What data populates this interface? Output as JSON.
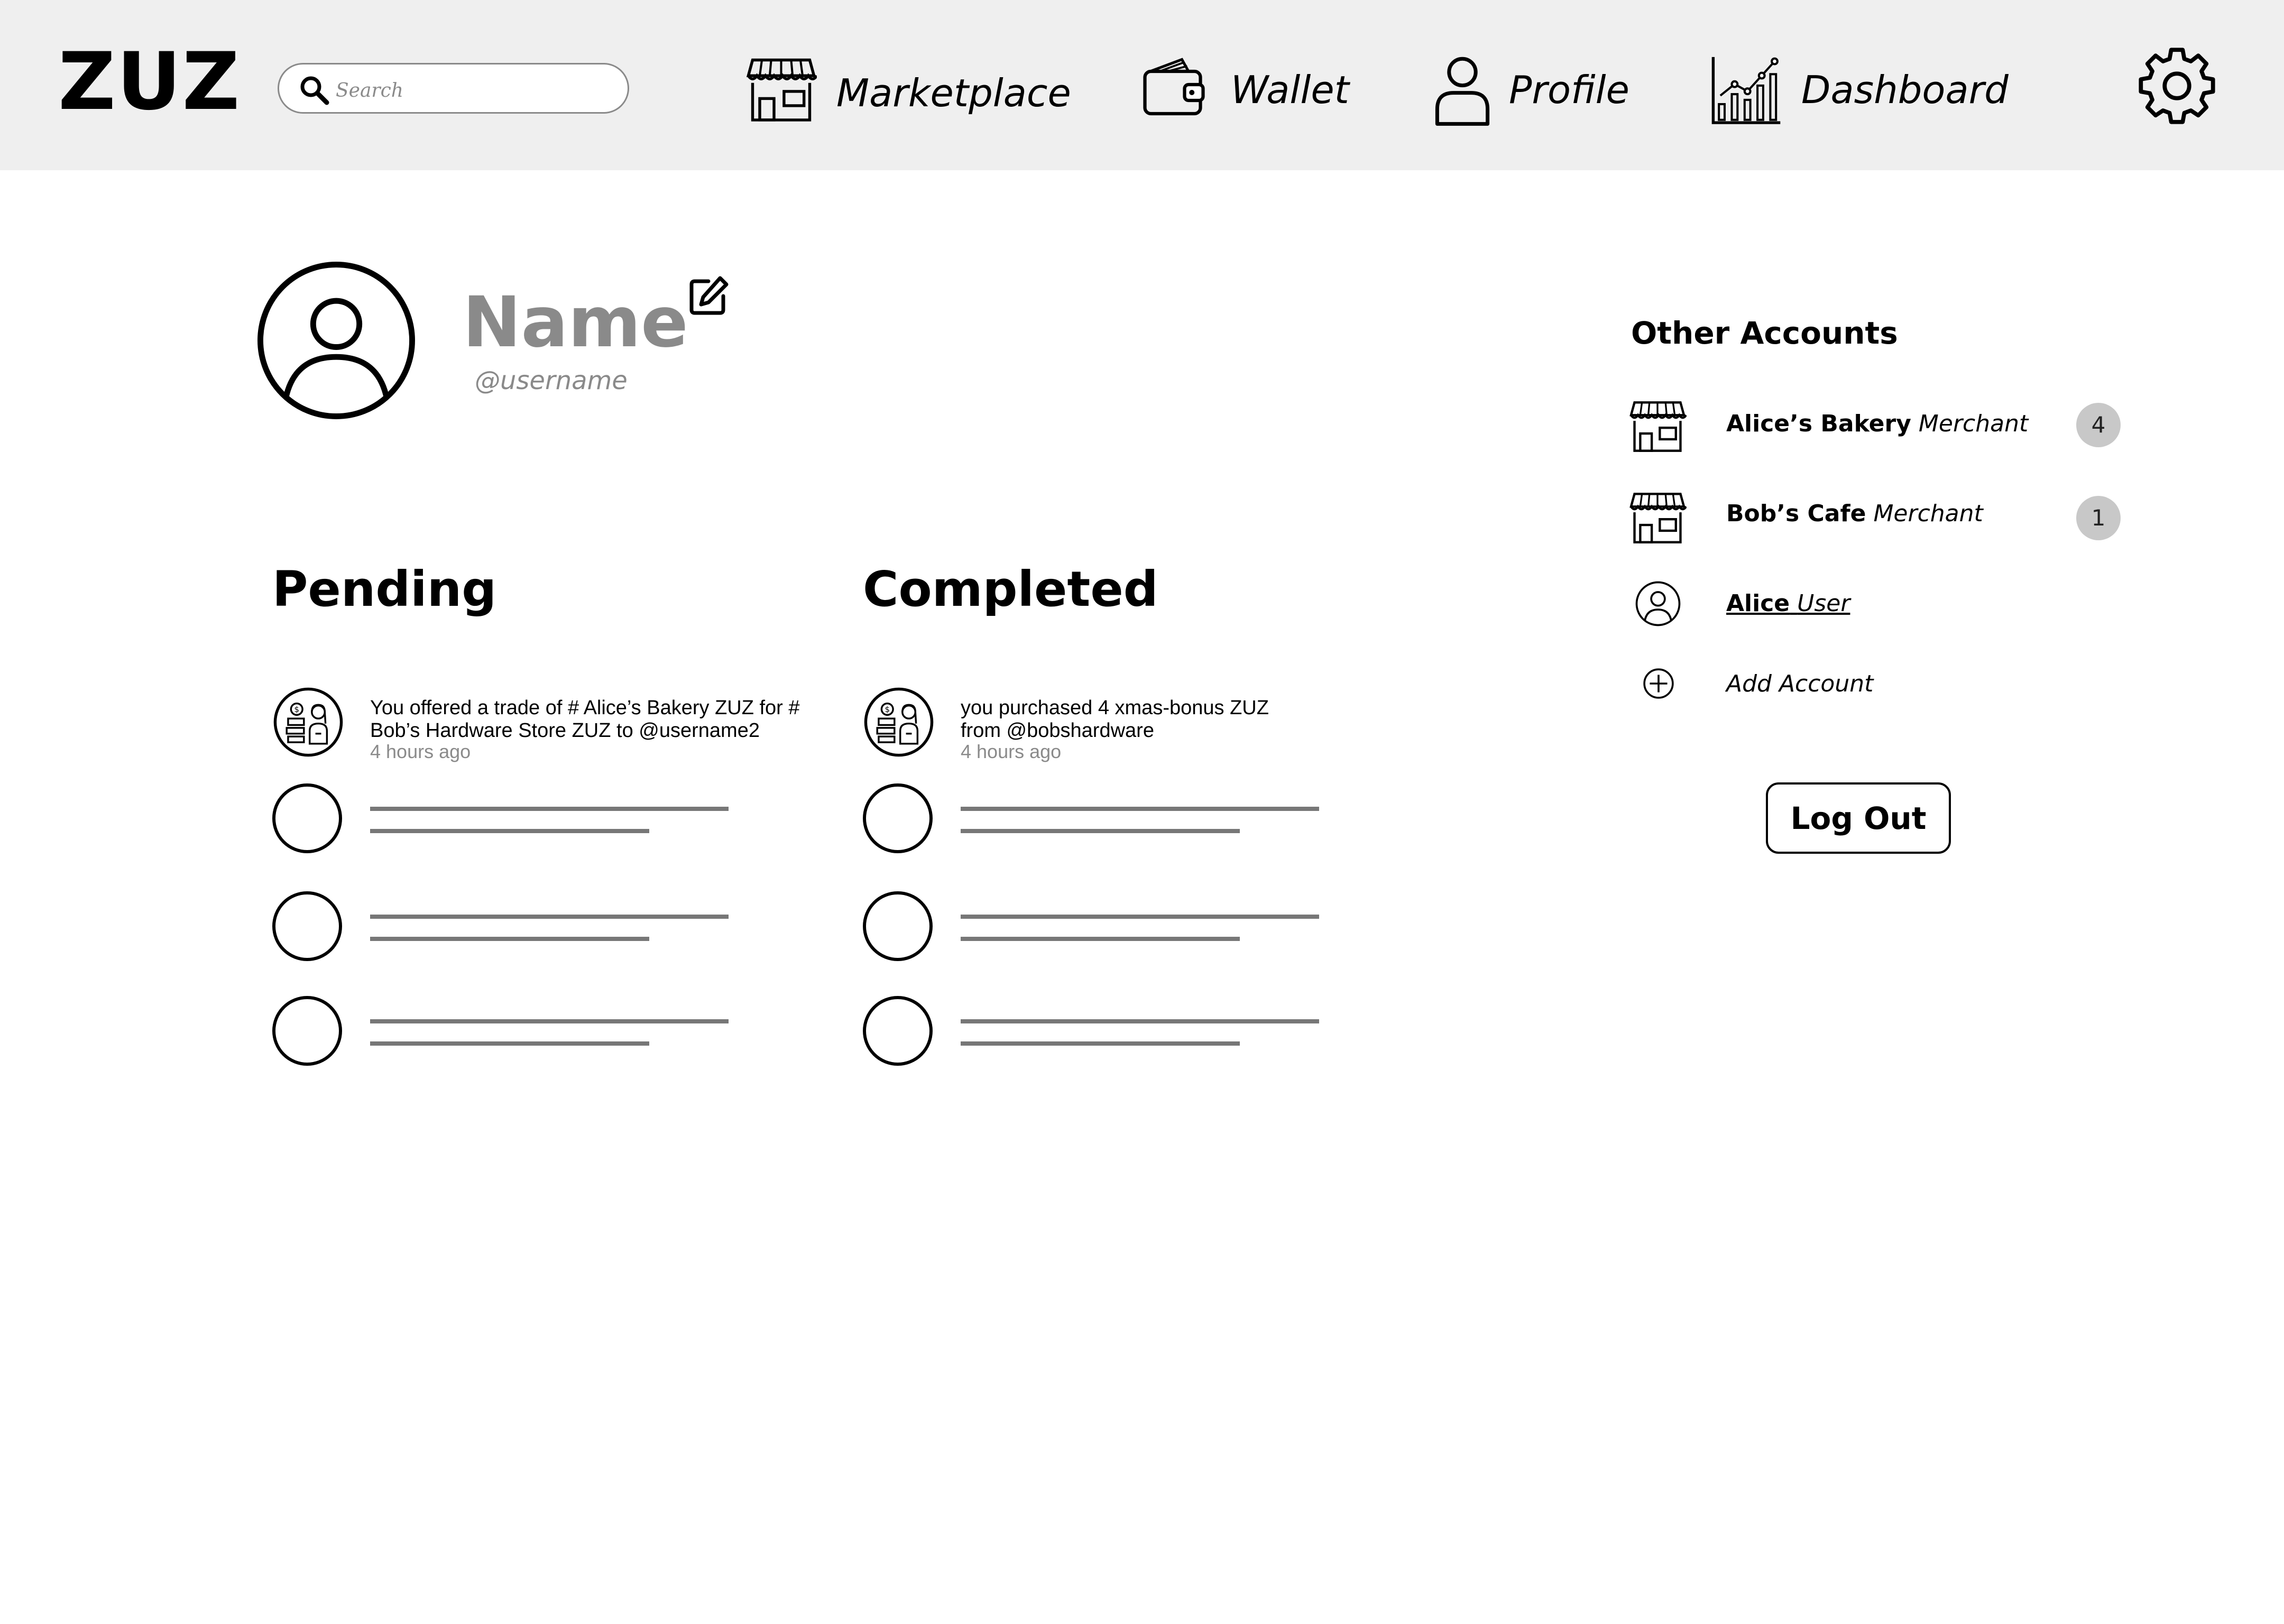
{
  "app": {
    "logo": "ZUZ"
  },
  "search": {
    "placeholder": "Search"
  },
  "nav": {
    "items": [
      {
        "label": "Marketplace",
        "icon": "storefront-icon"
      },
      {
        "label": "Wallet",
        "icon": "wallet-icon"
      },
      {
        "label": "Profile",
        "icon": "person-icon"
      },
      {
        "label": "Dashboard",
        "icon": "bar-chart-icon"
      }
    ],
    "settings_icon": "gear-icon"
  },
  "profile": {
    "name": "Name",
    "username": "@username"
  },
  "pending": {
    "title": "Pending",
    "items": [
      {
        "text": "You offered a trade of # Alice’s Bakery ZUZ for # Bob’s Hardware Store ZUZ to @username2",
        "time": "4 hours ago"
      }
    ]
  },
  "completed": {
    "title": "Completed",
    "items": [
      {
        "text": "you purchased 4 xmas-bonus ZUZ from @bobshardware",
        "time": "4 hours ago"
      }
    ]
  },
  "other_accounts": {
    "title": "Other Accounts",
    "accounts": [
      {
        "name": "Alice’s Bakery",
        "type": "Merchant",
        "badge": "4",
        "icon": "storefront-icon"
      },
      {
        "name": "Bob’s Cafe",
        "type": "Merchant",
        "badge": "1",
        "icon": "storefront-icon"
      },
      {
        "name": "Alice",
        "type": "User",
        "icon": "user-circle-icon"
      }
    ],
    "add_label": "Add Account"
  },
  "logout_label": "Log Out",
  "colors": {
    "topbar_bg": "#efefef",
    "muted_text": "#8a8a8a",
    "badge_bg": "#c8c8c8"
  }
}
